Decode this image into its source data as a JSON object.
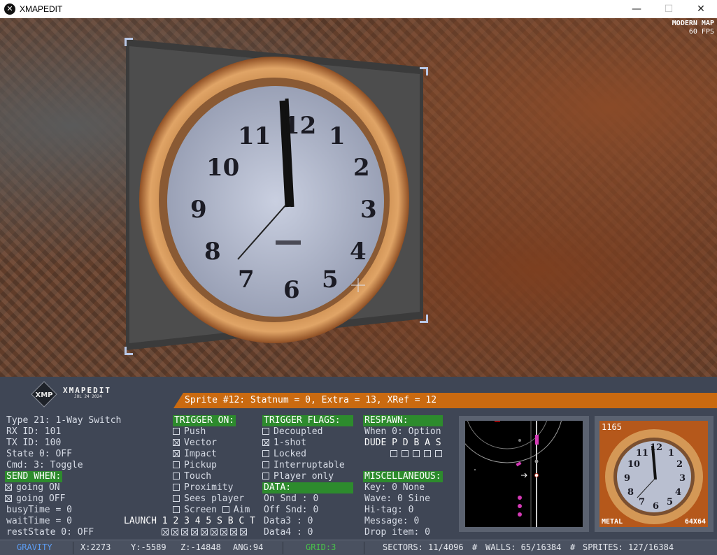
{
  "window": {
    "title": "XMAPEDIT",
    "app_icon": "x-logo-icon",
    "controls": {
      "minimize": "—",
      "maximize": "☐",
      "close": "✕"
    }
  },
  "viewport": {
    "mode_label": "MODERN MAP",
    "fps_label": "60 FPS"
  },
  "logo": {
    "badge": "XMP",
    "name": "XMAPEDIT",
    "date": "JUL 24 2024"
  },
  "sprite_bar": "Sprite #12: Statnum = 0, Extra = 13, XRef = 12",
  "info": {
    "type": "Type   21: 1-Way Switch",
    "rx_id": "RX ID: 101",
    "tx_id": "TX ID: 100",
    "state": "State  0: OFF",
    "cmd": "Cmd:   3: Toggle",
    "send_when_header": "SEND WHEN:",
    "going_on": "going ON",
    "going_off": "going OFF",
    "busy_time": "busyTime = 0",
    "wait_time": "waitTime = 0",
    "rest_state": "restState 0: OFF"
  },
  "trigger_on": {
    "header": "TRIGGER ON:",
    "items": [
      {
        "label": "Push",
        "checked": false
      },
      {
        "label": "Vector",
        "checked": true
      },
      {
        "label": "Impact",
        "checked": true
      },
      {
        "label": "Pickup",
        "checked": false
      },
      {
        "label": "Touch",
        "checked": false
      },
      {
        "label": "Proximity",
        "checked": false
      },
      {
        "label": "Sees player",
        "checked": false
      }
    ],
    "screen_label": "Screen",
    "aim_label": "Aim"
  },
  "launch": {
    "label": "LAUNCH",
    "options": [
      "1",
      "2",
      "3",
      "4",
      "5",
      "S",
      "B",
      "C",
      "T"
    ],
    "checked": [
      true,
      true,
      true,
      true,
      true,
      true,
      true,
      true,
      true
    ]
  },
  "trigger_flags": {
    "header": "TRIGGER FLAGS:",
    "items": [
      {
        "label": "Decoupled",
        "checked": false
      },
      {
        "label": "1-shot",
        "checked": true
      },
      {
        "label": "Locked",
        "checked": false
      },
      {
        "label": "Interruptable",
        "checked": false
      },
      {
        "label": "Player only",
        "checked": false
      }
    ]
  },
  "data": {
    "header": "DATA:",
    "on_snd": "On Snd : 0",
    "off_snd": "Off Snd: 0",
    "data3": "Data3  : 0",
    "data4": "Data4  : 0"
  },
  "respawn": {
    "header": "RESPAWN:",
    "when": "When 0: Option",
    "dude_label": "DUDE P D B A S",
    "dude_flags": [
      false,
      false,
      false,
      false,
      false
    ]
  },
  "misc": {
    "header": "MISCELLANEOUS:",
    "key": "Key:  0 None",
    "wave": "Wave: 0 Sine",
    "hitag": "Hi-tag: 0",
    "message": "Message:   0",
    "drop_item": "Drop item: 0"
  },
  "preview": {
    "tile_number": "1165",
    "material": "METAL",
    "size": "64X64"
  },
  "status": {
    "gravity": "GRAVITY",
    "x": "X:2273",
    "y": "Y:-5589",
    "z": "Z:-14848",
    "ang": "ANG:94",
    "grid": "GRID:3",
    "sectors": "SECTORS: 11/4096",
    "walls": "WALLS: 65/16384",
    "sprites": "SPRITES: 127/16384"
  },
  "colors": {
    "panel_bg": "#3f4655",
    "header_green": "#2d8b2d",
    "sprite_bar_orange": "#ca6a10",
    "gravity_blue": "#5d9ef5",
    "grid_green": "#49c44a"
  }
}
